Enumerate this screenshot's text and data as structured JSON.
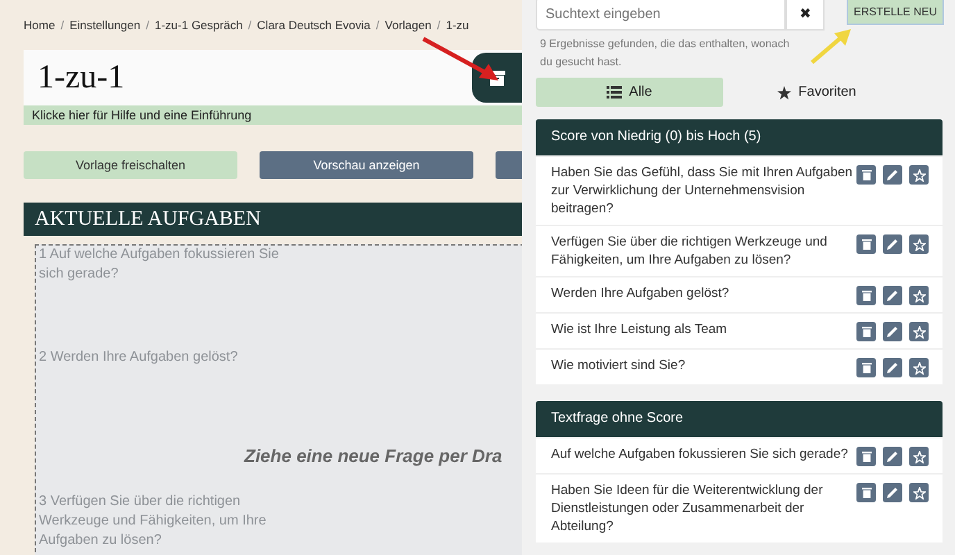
{
  "breadcrumb": {
    "separator": "/",
    "items": [
      "Home",
      "Einstellungen",
      "1-zu-1 Gespräch",
      "Clara Deutsch Evovia",
      "Vorlagen",
      "1-zu"
    ]
  },
  "template": {
    "title": "1-zu-1",
    "help": "Klicke hier für Hilfe und eine Einführung"
  },
  "actions": [
    {
      "label": "Vorlage freischalten",
      "kind": "primary"
    },
    {
      "label": "Vorschau anzeigen",
      "kind": "secondary"
    },
    {
      "kind": "secondary"
    }
  ],
  "tasks": {
    "title": "AKTUELLE AUFGABEN",
    "questions": [
      "1 Auf welche Aufgaben fokussieren Sie sich gerade?",
      "2 Werden Ihre Aufgaben gelöst?",
      "3 Verfügen Sie über die richtigen Werkzeuge und Fähigkeiten, um Ihre Aufgaben zu lösen?"
    ],
    "drop_hint": "Ziehe eine neue Frage per Dra"
  },
  "search": {
    "placeholder": "Suchtext eingeben",
    "clear": "✖",
    "create": "ERSTELLE NEU",
    "results": "9 Ergebnisse gefunden, die das enthalten, wonach du gesucht hast."
  },
  "tabs": [
    {
      "label": "Alle",
      "selected": true,
      "kind": "list"
    },
    {
      "label": "Favoriten",
      "selected": false,
      "kind": "star"
    }
  ],
  "groups": [
    {
      "title": "Score von Niedrig (0) bis Hoch (5)",
      "questions": [
        "Haben Sie das Gefühl, dass Sie mit Ihren Aufgaben zur Verwirklichung der Unternehmensvision beitragen?",
        "Verfügen Sie über die richtigen Werkzeuge und Fähigkeiten, um Ihre Aufgaben zu lösen?",
        "Werden Ihre Aufgaben gelöst?",
        "Wie ist Ihre Leistung als Team",
        "Wie motiviert sind Sie?"
      ]
    },
    {
      "title": "Textfrage ohne Score",
      "questions": [
        "Auf welche Aufgaben fokussieren Sie sich gerade?",
        "Haben Sie Ideen für die Weiterentwicklung der Dienstleistungen oder Zusammenarbeit der Abteilung?"
      ]
    }
  ]
}
